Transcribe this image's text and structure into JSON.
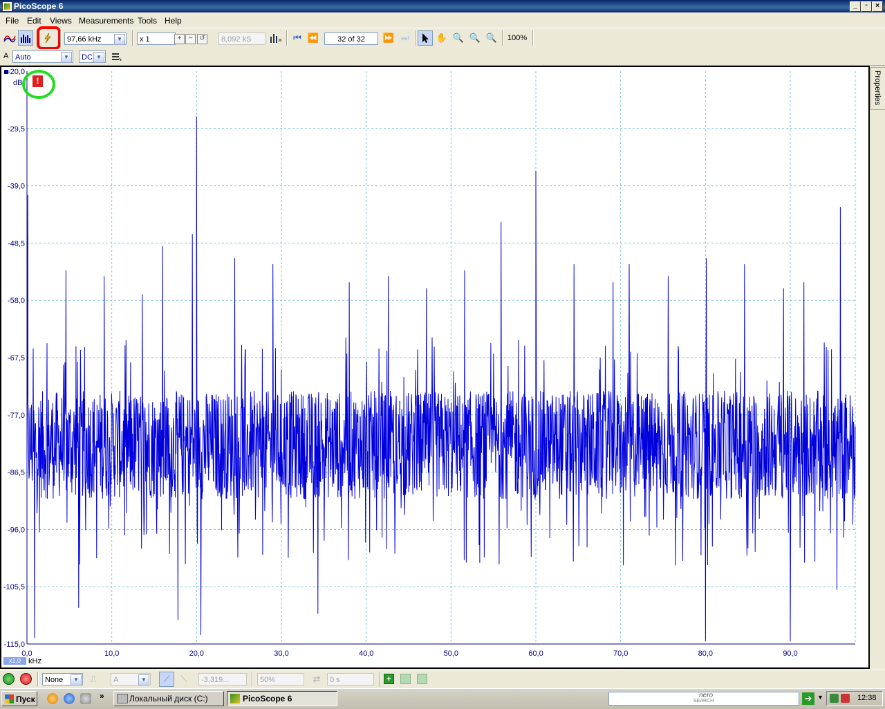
{
  "window": {
    "title": "PicoScope 6"
  },
  "menu": [
    {
      "label": "File"
    },
    {
      "label": "Edit"
    },
    {
      "label": "Views"
    },
    {
      "label": "Measurements"
    },
    {
      "label": "Tools"
    },
    {
      "label": "Help"
    }
  ],
  "toolbar": {
    "frequency": "97,66 kHz",
    "multiplier": "x 1",
    "samples": "8,092 kS",
    "buffer": "32 of 32",
    "zoom": "100%"
  },
  "channel": {
    "name": "A",
    "range": "Auto",
    "coupling": "DC"
  },
  "plot": {
    "y_unit": "dB",
    "x_unit": "kHz",
    "scale_badge": "x1,0",
    "alert_glyph": "!",
    "trace_color": "#0000dd",
    "properties_tab": "Properties"
  },
  "chart_data": {
    "type": "line",
    "title": "",
    "xlabel": "kHz",
    "ylabel": "dB",
    "xlim": [
      0,
      97.66
    ],
    "ylim": [
      -115.0,
      -20.0
    ],
    "x_ticks": [
      "0,0",
      "10,0",
      "20,0",
      "30,0",
      "40,0",
      "50,0",
      "60,0",
      "70,0",
      "80,0",
      "90,0"
    ],
    "y_ticks": [
      "-20,0",
      "-29,5",
      "-39,0",
      "-48,5",
      "-58,0",
      "-67,5",
      "-77,0",
      "-86,5",
      "-96,0",
      "-105,5",
      "-115,0"
    ],
    "grid": true,
    "noise_floor": [
      -92,
      -72
    ],
    "peaks": [
      {
        "x": 0.1,
        "y": -40.5
      },
      {
        "x": 4.6,
        "y": -53
      },
      {
        "x": 9.1,
        "y": -54
      },
      {
        "x": 13.6,
        "y": -57
      },
      {
        "x": 16.0,
        "y": -49
      },
      {
        "x": 19.5,
        "y": -47
      },
      {
        "x": 20.0,
        "y": -27.5
      },
      {
        "x": 24.5,
        "y": -51
      },
      {
        "x": 29.0,
        "y": -52
      },
      {
        "x": 38.0,
        "y": -55
      },
      {
        "x": 42.6,
        "y": -54
      },
      {
        "x": 47.1,
        "y": -56
      },
      {
        "x": 51.6,
        "y": -53
      },
      {
        "x": 55.9,
        "y": -45
      },
      {
        "x": 60.0,
        "y": -36.5
      },
      {
        "x": 64.5,
        "y": -52
      },
      {
        "x": 69.1,
        "y": -55
      },
      {
        "x": 71.0,
        "y": -52
      },
      {
        "x": 75.6,
        "y": -54
      },
      {
        "x": 80.1,
        "y": -51
      },
      {
        "x": 84.6,
        "y": -52
      },
      {
        "x": 89.2,
        "y": -56
      },
      {
        "x": 91.6,
        "y": -55
      },
      {
        "x": 95.9,
        "y": -42.5
      }
    ],
    "dips": [
      {
        "x": 0.9,
        "y": -114
      },
      {
        "x": 6.1,
        "y": -109
      },
      {
        "x": 17.8,
        "y": -111
      },
      {
        "x": 20.5,
        "y": -113.5
      },
      {
        "x": 34.3,
        "y": -110
      },
      {
        "x": 80.0,
        "y": -114.5
      },
      {
        "x": 90.0,
        "y": -114.5
      },
      {
        "x": 95.5,
        "y": -106
      }
    ]
  },
  "bottombar": {
    "trigger_mode": "None",
    "trigger_channel": "A",
    "trigger_level": "-3,319...",
    "trigger_percent": "50%",
    "trigger_delay": "0 s"
  },
  "taskbar": {
    "start": "Пуск",
    "items": [
      {
        "label": "Локальный диск (C:)"
      },
      {
        "label": "PicoScope 6"
      }
    ],
    "search_brand": "nero",
    "search_brand_sub": "SEARCH",
    "time": "12:38"
  }
}
